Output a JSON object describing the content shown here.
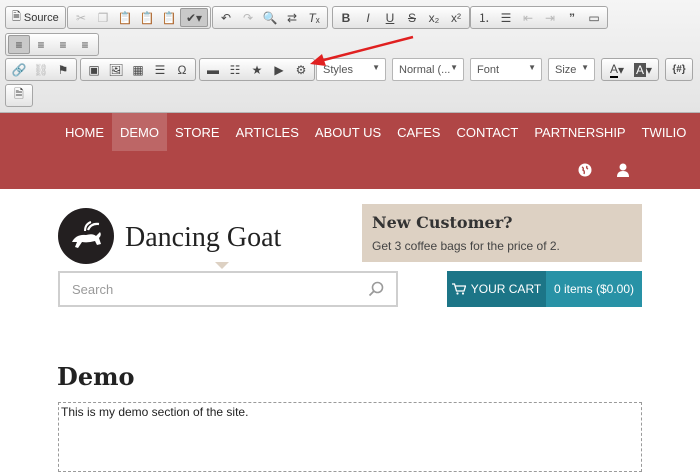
{
  "toolbar": {
    "source_label": "Source",
    "styles_combo": "Styles",
    "format_combo": "Normal (...",
    "font_combo": "Font",
    "size_combo": "Size",
    "placeholder_button": "{#}"
  },
  "nav": {
    "items": [
      "HOME",
      "DEMO",
      "STORE",
      "ARTICLES",
      "ABOUT US",
      "CAFES",
      "CONTACT",
      "PARTNERSHIP",
      "TWILIO"
    ],
    "active_index": 1,
    "bg_color": "#b04646"
  },
  "brand": {
    "name": "Dancing Goat"
  },
  "promo": {
    "title": "New Customer?",
    "subtitle": "Get 3 coffee bags for the price of 2."
  },
  "search": {
    "placeholder": "Search"
  },
  "cart": {
    "label": "YOUR CART",
    "summary": "0 items ($0.00)"
  },
  "content": {
    "title": "Demo",
    "body": "This is my demo section of the site."
  },
  "colors": {
    "accent_red": "#b04646",
    "cart_dark": "#1c7587",
    "cart_light": "#2892a6",
    "annotation_arrow": "#e02020"
  }
}
